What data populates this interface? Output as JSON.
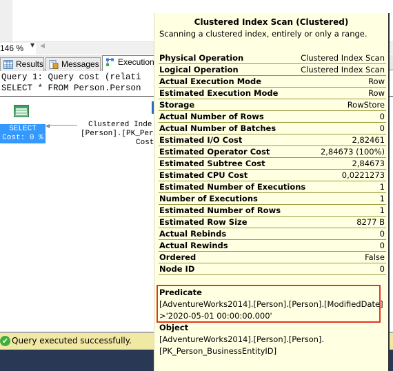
{
  "zoom": {
    "value": "146 %"
  },
  "tabs": [
    {
      "label": "Results",
      "icon": "grid-icon"
    },
    {
      "label": "Messages",
      "icon": "messages-icon"
    },
    {
      "label": "Execution",
      "icon": "execution-plan-icon"
    }
  ],
  "results": {
    "query_line": "Query 1: Query cost (relati",
    "sql_line": "SELECT * FROM Person.Person",
    "select_node": {
      "line1": "SELECT",
      "line2": "Cost: 0 %"
    },
    "ci_node": {
      "line1": "Clustered Inde:",
      "line2": "[Person].[PK_Pers",
      "line3": "Cost"
    }
  },
  "tooltip": {
    "title": "Clustered Index Scan (Clustered)",
    "description": "Scanning a clustered index, entirely or only a range.",
    "properties": [
      {
        "key": "Physical Operation",
        "value": "Clustered Index Scan"
      },
      {
        "key": "Logical Operation",
        "value": "Clustered Index Scan"
      },
      {
        "key": "Actual Execution Mode",
        "value": "Row"
      },
      {
        "key": "Estimated Execution Mode",
        "value": "Row"
      },
      {
        "key": "Storage",
        "value": "RowStore"
      },
      {
        "key": "Actual Number of Rows",
        "value": "0"
      },
      {
        "key": "Actual Number of Batches",
        "value": "0"
      },
      {
        "key": "Estimated I/O Cost",
        "value": "2,82461"
      },
      {
        "key": "Estimated Operator Cost",
        "value": "2,84673 (100%)"
      },
      {
        "key": "Estimated Subtree Cost",
        "value": "2,84673"
      },
      {
        "key": "Estimated CPU Cost",
        "value": "0,0221273"
      },
      {
        "key": "Estimated Number of Executions",
        "value": "1"
      },
      {
        "key": "Number of Executions",
        "value": "1"
      },
      {
        "key": "Estimated Number of Rows",
        "value": "1"
      },
      {
        "key": "Estimated Row Size",
        "value": "8277 B"
      },
      {
        "key": "Actual Rebinds",
        "value": "0"
      },
      {
        "key": "Actual Rewinds",
        "value": "0"
      },
      {
        "key": "Ordered",
        "value": "False"
      },
      {
        "key": "Node ID",
        "value": "0"
      }
    ],
    "predicate": {
      "title": "Predicate",
      "line1": "[AdventureWorks2014].[Person].[Person].[ModifiedDate]",
      "line2": ">'2020-05-01 00:00:00.000'",
      "highlight_color": "#e8321e"
    },
    "object": {
      "title": "Object",
      "line1": "[AdventureWorks2014].[Person].[Person].",
      "line2": "[PK_Person_BusinessEntityID]"
    }
  },
  "status": {
    "text": "Query executed successfully.",
    "icon": "success-check-icon"
  },
  "colors": {
    "tooltip_bg": "#ffffe1",
    "status_bg": "#f1e8a4",
    "selected_node": "#3399ff",
    "bottom_bar": "#293955"
  }
}
